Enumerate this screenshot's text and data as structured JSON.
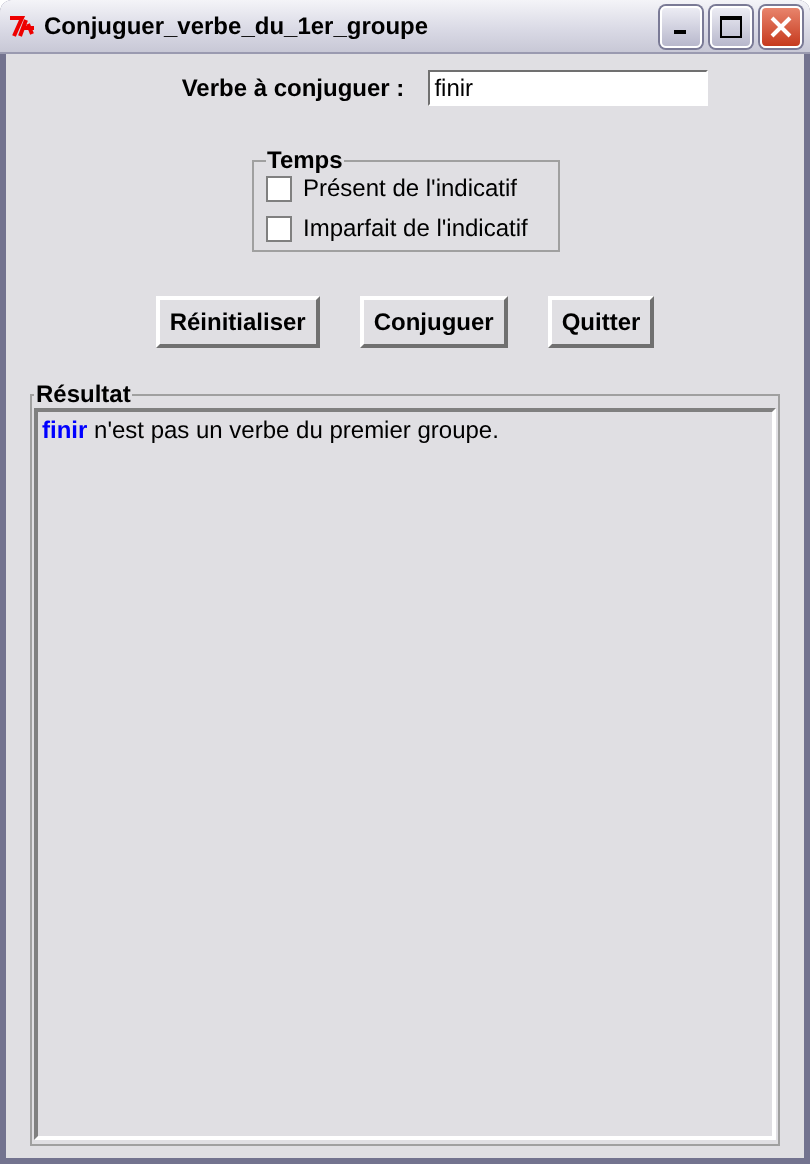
{
  "window": {
    "title": "Conjuguer_verbe_du_1er_groupe"
  },
  "verb_field": {
    "label": "Verbe à conjuguer :",
    "value": "finir"
  },
  "tense_group": {
    "title": "Temps",
    "options": [
      {
        "label": "Présent de l'indicatif",
        "checked": false
      },
      {
        "label": "Imparfait de l'indicatif",
        "checked": false
      }
    ]
  },
  "buttons": [
    "Réinitialiser",
    "Conjuguer",
    "Quitter"
  ],
  "result": {
    "title": "Résultat",
    "verb": "finir",
    "message": "n'est pas un verbe du premier groupe."
  }
}
